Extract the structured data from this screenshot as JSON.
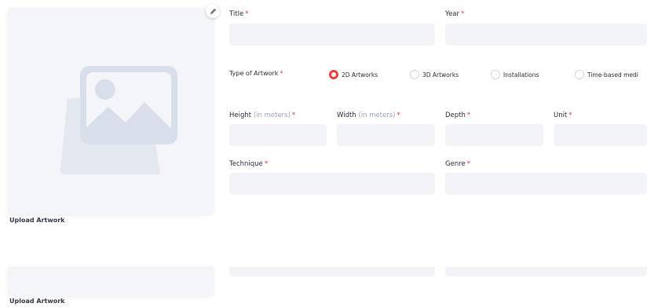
{
  "form": {
    "required_mark": "*",
    "title_label": "Title",
    "year_label": "Year",
    "type_label": "Type of Artwork",
    "artwork_types": [
      {
        "label": "2D Artworks",
        "checked": true
      },
      {
        "label": "3D Artworks",
        "checked": false
      },
      {
        "label": "Installations",
        "checked": false
      },
      {
        "label": "Time-based medi",
        "checked": false
      }
    ],
    "height_label": "Height",
    "height_hint": "(in meters)",
    "width_label": "Width",
    "width_hint": "(in meters)",
    "depth_label": "Depth",
    "unit_label": "Unit",
    "technique_label": "Technique",
    "genre_label": "Genre"
  },
  "upload": {
    "label_1": "Upload Artwork",
    "label_2": "Upload Artwork"
  },
  "icons": {
    "edit": "pencil-icon",
    "placeholder": "image-placeholder-icon"
  },
  "colors": {
    "required": "#e0304d",
    "radio_accent": "#e8423a",
    "field_bg": "#f2f4f8",
    "placeholder_icon": "#dfe4ee"
  }
}
